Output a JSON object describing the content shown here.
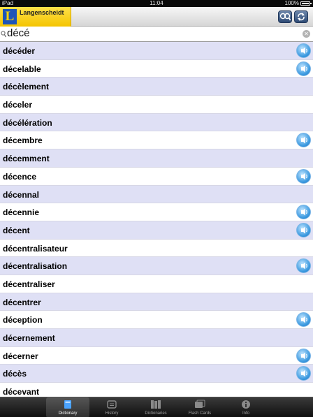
{
  "status_bar": {
    "device": "iPad",
    "time": "11:04",
    "battery": "100%"
  },
  "nav_bar": {
    "logo_letter": "L",
    "brand": "Langenscheidt"
  },
  "search": {
    "query": "décé"
  },
  "entries": [
    {
      "word": "décéder",
      "audio": true
    },
    {
      "word": "décelable",
      "audio": true
    },
    {
      "word": "décèlement",
      "audio": false
    },
    {
      "word": "déceler",
      "audio": false
    },
    {
      "word": "décélération",
      "audio": false
    },
    {
      "word": "décembre",
      "audio": true
    },
    {
      "word": "décemment",
      "audio": false
    },
    {
      "word": "décence",
      "audio": true
    },
    {
      "word": "décennal",
      "audio": false
    },
    {
      "word": "décennie",
      "audio": true
    },
    {
      "word": "décent",
      "audio": true
    },
    {
      "word": "décentralisateur",
      "audio": false
    },
    {
      "word": "décentralisation",
      "audio": true
    },
    {
      "word": "décentraliser",
      "audio": false
    },
    {
      "word": "décentrer",
      "audio": false
    },
    {
      "word": "déception",
      "audio": true
    },
    {
      "word": "décernement",
      "audio": false
    },
    {
      "word": "décerner",
      "audio": true
    },
    {
      "word": "décès",
      "audio": true
    },
    {
      "word": "décevant",
      "audio": false
    }
  ],
  "tabs": [
    {
      "label": "Dictionary",
      "icon": "dictionary-icon",
      "active": true
    },
    {
      "label": "History",
      "icon": "history-icon",
      "active": false
    },
    {
      "label": "Dictionaries",
      "icon": "dictionaries-icon",
      "active": false
    },
    {
      "label": "Flash Cards",
      "icon": "flash-cards-icon",
      "active": false
    },
    {
      "label": "Info",
      "icon": "info-icon",
      "active": false
    }
  ],
  "colors": {
    "accent": "#f4c400",
    "brand_blue": "#1d54b9",
    "row_alt": "#dfe0f5",
    "speaker": "#3b9ae0"
  }
}
